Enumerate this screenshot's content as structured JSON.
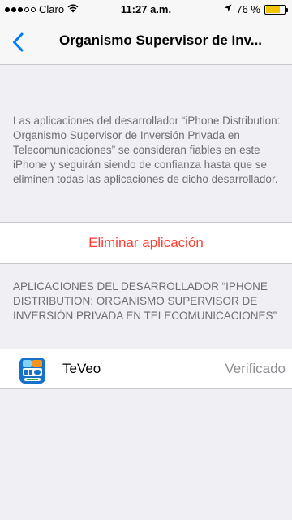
{
  "status_bar": {
    "carrier": "Claro",
    "time": "11:27 a.m.",
    "battery": "76 %",
    "battery_level": 0.76,
    "signal_bars_filled": 3,
    "signal_bars_total": 5
  },
  "nav": {
    "back_icon": "chevron-left-icon",
    "title": "Organismo Supervisor de Inv..."
  },
  "description": "Las aplicaciones del desarrollador “iPhone Distribution: Organismo Supervisor de Inversión Privada en Telecomunicaciones” se consideran fiables en este iPhone y seguirán siendo de confianza hasta que se eliminen todas las aplicaciones de dicho desarrollador.",
  "delete_button": "Eliminar aplicación",
  "section_header": "APLICACIONES DEL DESARROLLADOR “IPHONE DISTRIBUTION: ORGANISMO SUPERVISOR DE INVERSIÓN PRIVADA EN TELECOMUNICACIONES”",
  "apps": [
    {
      "name": "TeVeo",
      "status": "Verificado",
      "icon": "teveo-app-icon"
    }
  ],
  "colors": {
    "accent": "#007aff",
    "destructive": "#ff3b30",
    "battery": "#f5c400",
    "background": "#efeff4"
  }
}
